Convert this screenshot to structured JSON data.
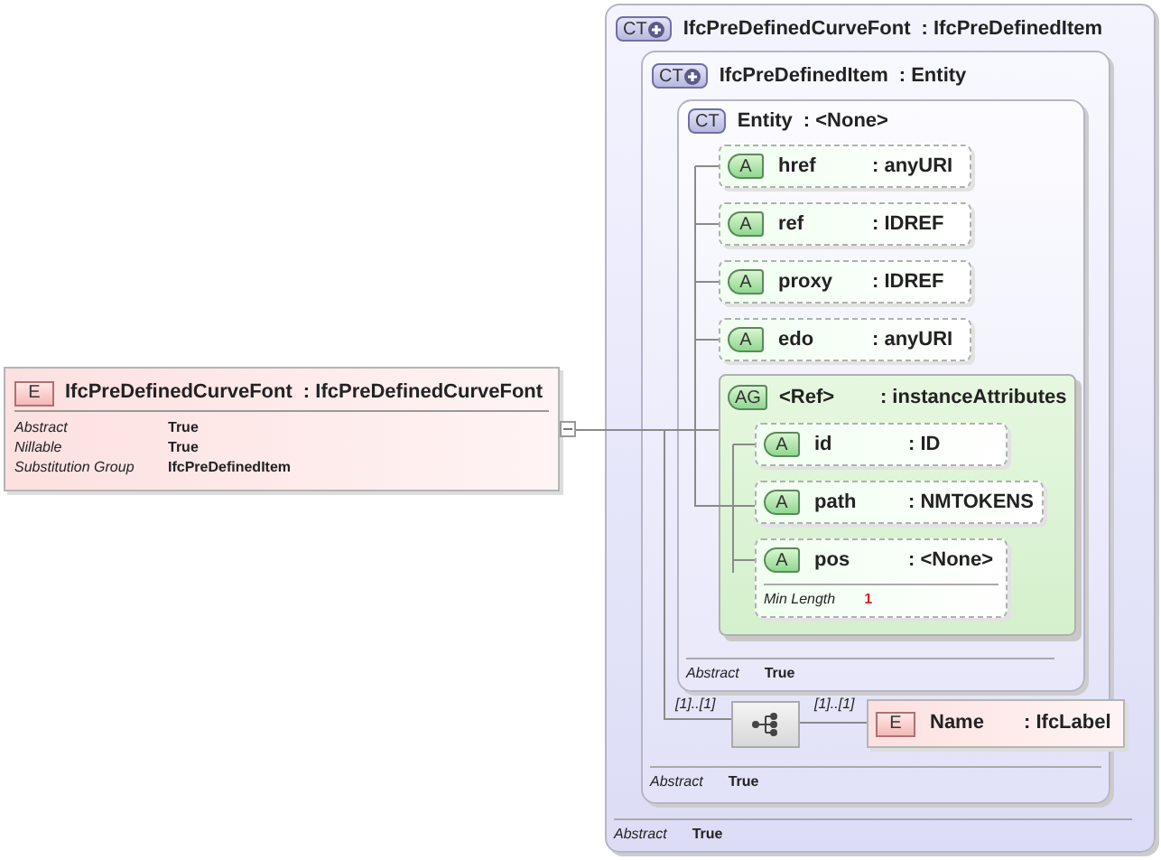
{
  "element": {
    "badge": "E",
    "name": "IfcPreDefinedCurveFont",
    "type": ": IfcPreDefinedCurveFont",
    "properties": [
      {
        "label": "Abstract",
        "value": "True"
      },
      {
        "label": "Nillable",
        "value": "True"
      },
      {
        "label": "Substitution Group",
        "value": "IfcPreDefinedItem"
      }
    ]
  },
  "complex_type": {
    "badge": "CT",
    "name": "IfcPreDefinedCurveFont",
    "type": ": IfcPreDefinedItem",
    "footer": {
      "label": "Abstract",
      "value": "True"
    },
    "base": {
      "badge": "CT",
      "name": "IfcPreDefinedItem",
      "type": ": Entity",
      "footer": {
        "label": "Abstract",
        "value": "True"
      },
      "sequence": {
        "min_label": "[1]..[1]",
        "element": {
          "cardinality": "[1]..[1]",
          "badge": "E",
          "name": "Name",
          "type": ": IfcLabel"
        }
      },
      "base": {
        "badge": "CT",
        "name": "Entity",
        "type": ": <None>",
        "footer": {
          "label": "Abstract",
          "value": "True"
        },
        "attributes": [
          {
            "badge": "A",
            "name": "href",
            "type": ": anyURI"
          },
          {
            "badge": "A",
            "name": "ref",
            "type": ": IDREF"
          },
          {
            "badge": "A",
            "name": "proxy",
            "type": ": IDREF"
          },
          {
            "badge": "A",
            "name": "edo",
            "type": ": anyURI"
          }
        ],
        "attribute_group": {
          "badge": "AG",
          "name": "<Ref>",
          "type": ": instanceAttributes",
          "attributes": [
            {
              "badge": "A",
              "name": "id",
              "type": ": ID"
            },
            {
              "badge": "A",
              "name": "path",
              "type": ": NMTOKENS"
            },
            {
              "badge": "A",
              "name": "pos",
              "type": ": <None>",
              "facet": {
                "label": "Min Length",
                "value": "1"
              }
            }
          ]
        }
      }
    }
  }
}
